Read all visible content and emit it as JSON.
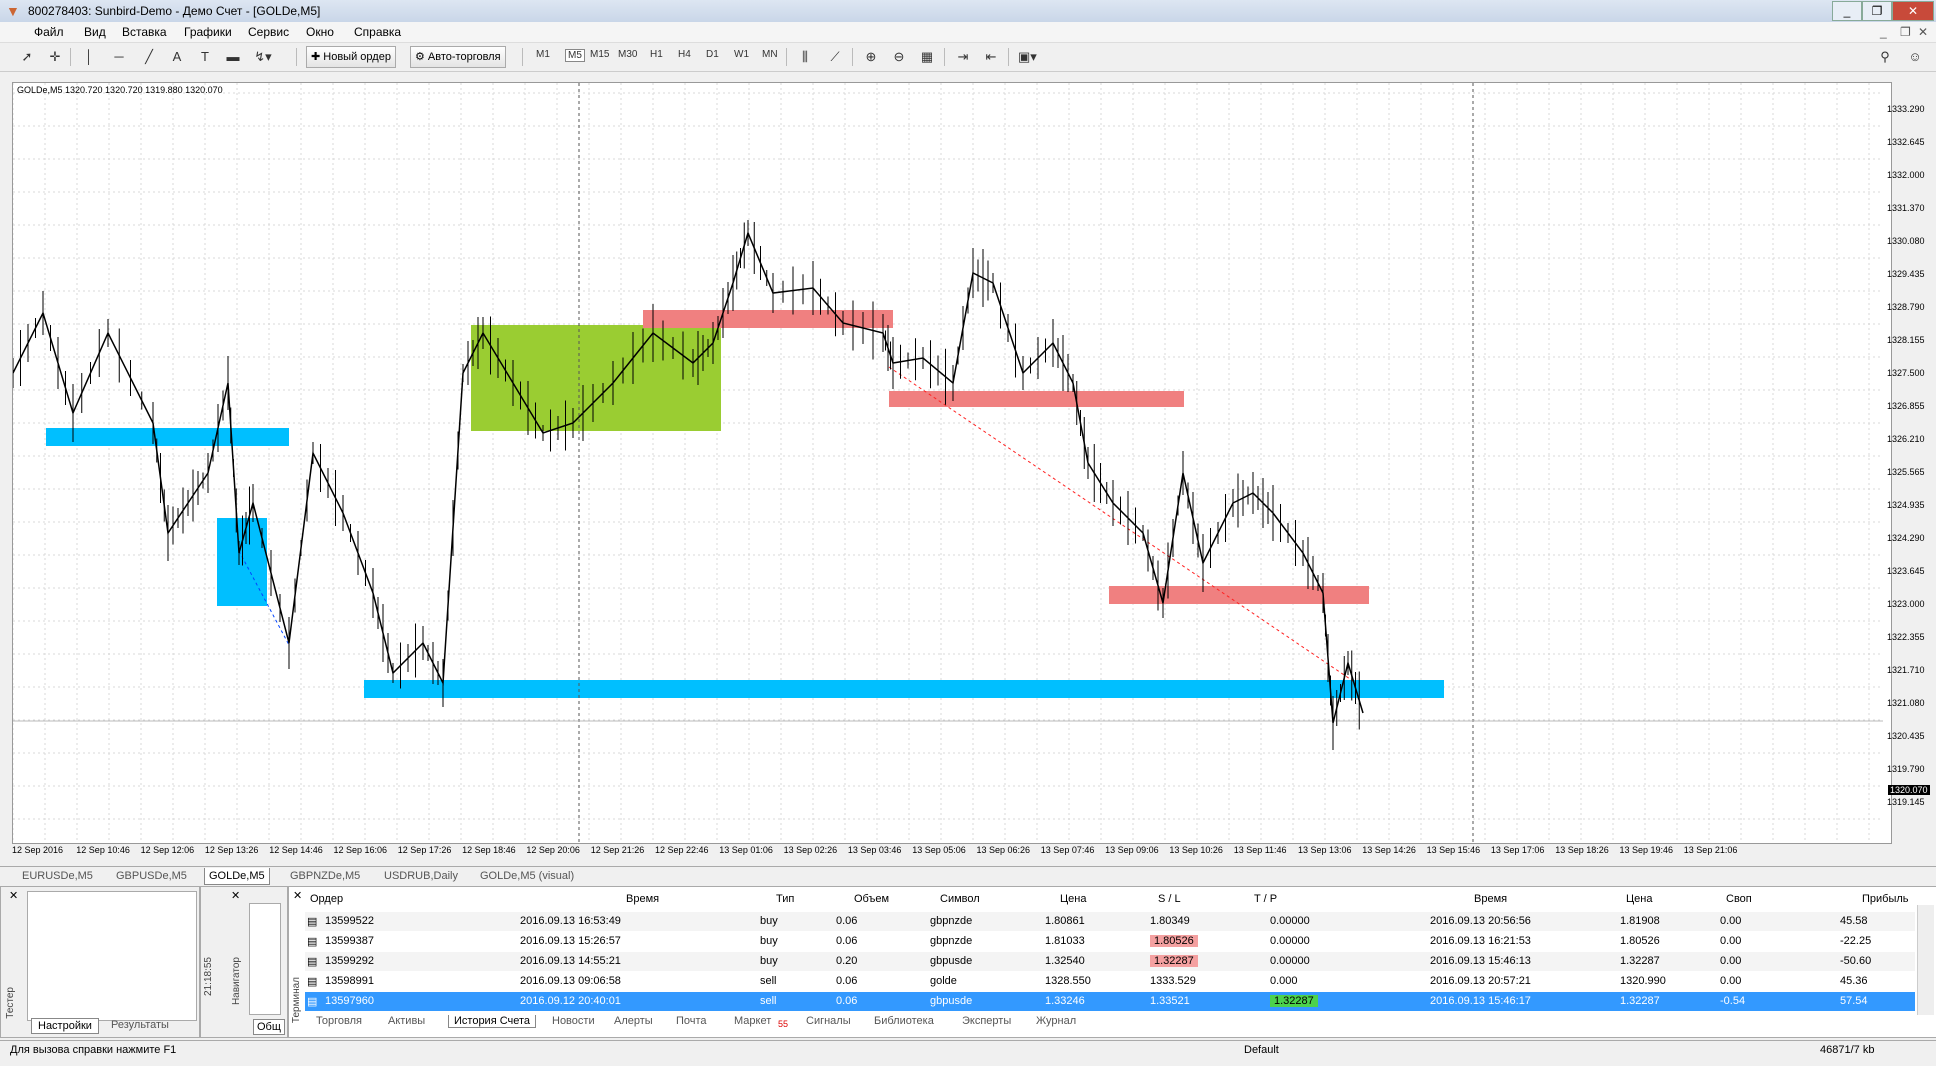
{
  "window": {
    "title": "800278403: Sunbird-Demo - Демо Счет - [GOLDe,M5]",
    "min": "_",
    "restore": "❐",
    "close": "✕"
  },
  "menu": [
    "Файл",
    "Вид",
    "Вставка",
    "Графики",
    "Сервис",
    "Окно",
    "Справка"
  ],
  "toolbar": {
    "new_order": "Новый ордер",
    "auto_trading": "Авто-торговля",
    "timeframes": [
      "M1",
      "M5",
      "M15",
      "M30",
      "H1",
      "H4",
      "D1",
      "W1",
      "MN"
    ],
    "active_timeframe": "M5"
  },
  "chart": {
    "header": "GOLDe,M5  1320.720 1320.720 1319.880 1320.070",
    "current_price": "1320.070",
    "y_ticks": [
      "1333.290",
      "1332.645",
      "1332.000",
      "1331.370",
      "1330.080",
      "1329.435",
      "1328.790",
      "1328.155",
      "1327.500",
      "1326.855",
      "1326.210",
      "1325.565",
      "1324.935",
      "1324.290",
      "1323.645",
      "1323.000",
      "1322.355",
      "1321.710",
      "1321.080",
      "1320.435",
      "1319.790",
      "1319.145"
    ],
    "x_ticks": [
      "12 Sep 2016",
      "12 Sep 10:46",
      "12 Sep 12:06",
      "12 Sep 13:26",
      "12 Sep 14:46",
      "12 Sep 16:06",
      "12 Sep 17:26",
      "12 Sep 18:46",
      "12 Sep 20:06",
      "12 Sep 21:26",
      "12 Sep 22:46",
      "13 Sep 01:06",
      "13 Sep 02:26",
      "13 Sep 03:46",
      "13 Sep 05:06",
      "13 Sep 06:26",
      "13 Sep 07:46",
      "13 Sep 09:06",
      "13 Sep 10:26",
      "13 Sep 11:46",
      "13 Sep 13:06",
      "13 Sep 14:26",
      "13 Sep 15:46",
      "13 Sep 17:06",
      "13 Sep 18:26",
      "13 Sep 19:46",
      "13 Sep 21:06"
    ],
    "colors": {
      "blue_zone": "#00bfff",
      "red_zone": "#f08080",
      "green_zone": "#9acd32"
    }
  },
  "chart_tabs": [
    "EURUSDe,M5",
    "GBPUSDe,M5",
    "GOLDe,M5",
    "GBPNZDe,M5",
    "USDRUB,Daily",
    "GOLDe,M5 (visual)"
  ],
  "active_chart_tab": "GOLDe,M5",
  "tester": {
    "label": "Тестер",
    "tabs": [
      "Настройки",
      "Результаты"
    ],
    "time": "21:18:55"
  },
  "navigator": {
    "label": "Навигатор",
    "tab": "Общ"
  },
  "terminal": {
    "label": "Терминал",
    "headers": [
      "Ордер",
      "Время",
      "Тип",
      "Объем",
      "Символ",
      "Цена",
      "S / L",
      "T / P",
      "Время",
      "Цена",
      "Своп",
      "Прибыль"
    ],
    "rows": [
      [
        "13599522",
        "2016.09.13 16:53:49",
        "buy",
        "0.06",
        "gbpnzde",
        "1.80861",
        "1.80349",
        "0.00000",
        "2016.09.13 20:56:56",
        "1.81908",
        "0.00",
        "45.58"
      ],
      [
        "13599387",
        "2016.09.13 15:26:57",
        "buy",
        "0.06",
        "gbpnzde",
        "1.81033",
        "1.80526",
        "0.00000",
        "2016.09.13 16:21:53",
        "1.80526",
        "0.00",
        "-22.25"
      ],
      [
        "13599292",
        "2016.09.13 14:55:21",
        "buy",
        "0.20",
        "gbpusde",
        "1.32540",
        "1.32287",
        "0.00000",
        "2016.09.13 15:46:13",
        "1.32287",
        "0.00",
        "-50.60"
      ],
      [
        "13598991",
        "2016.09.13 09:06:58",
        "sell",
        "0.06",
        "golde",
        "1328.550",
        "1333.529",
        "0.000",
        "2016.09.13 20:57:21",
        "1320.990",
        "0.00",
        "45.36"
      ],
      [
        "13597960",
        "2016.09.12 20:40:01",
        "sell",
        "0.06",
        "gbpusde",
        "1.33246",
        "1.33521",
        "1.32287",
        "2016.09.13 15:46:17",
        "1.32287",
        "-0.54",
        "57.54"
      ]
    ],
    "tabs": [
      "Торговля",
      "Активы",
      "История Счета",
      "Новости",
      "Алерты",
      "Почта",
      "Маркет",
      "Сигналы",
      "Библиотека",
      "Эксперты",
      "Журнал"
    ],
    "active_tab": "История Счета",
    "market_badge": "55"
  },
  "status": {
    "help": "Для вызова справки нажмите F1",
    "profile": "Default",
    "traffic": "46871/7 kb"
  }
}
